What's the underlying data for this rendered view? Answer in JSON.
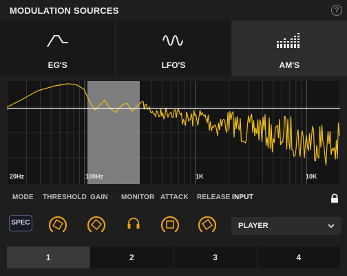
{
  "header": {
    "title": "MODULATION SOURCES",
    "help": "?"
  },
  "tabs": [
    {
      "label": "EG'S",
      "icon": "envelope-icon",
      "active": false
    },
    {
      "label": "LFO'S",
      "icon": "wave-icon",
      "active": false
    },
    {
      "label": "AM'S",
      "icon": "spectrum-bars-icon",
      "active": true
    }
  ],
  "spectrum": {
    "freq_labels": [
      "20Hz",
      "100Hz",
      "1K",
      "10K"
    ],
    "selected_band": "100Hz",
    "trace_color": "#f2c21a",
    "threshold_color": "#ffffff"
  },
  "controls": {
    "labels": {
      "mode": "MODE",
      "threshold": "THRESHOLD",
      "gain": "GAIN",
      "monitor": "MONITOR",
      "attack": "ATTACK",
      "release": "RELEASE",
      "input": "INPUT"
    },
    "mode_button": "SPEC",
    "input_value": "PLAYER",
    "accent": "#e8a317"
  },
  "slots": [
    {
      "label": "1",
      "active": true
    },
    {
      "label": "2",
      "active": false
    },
    {
      "label": "3",
      "active": false
    },
    {
      "label": "4",
      "active": false
    }
  ]
}
